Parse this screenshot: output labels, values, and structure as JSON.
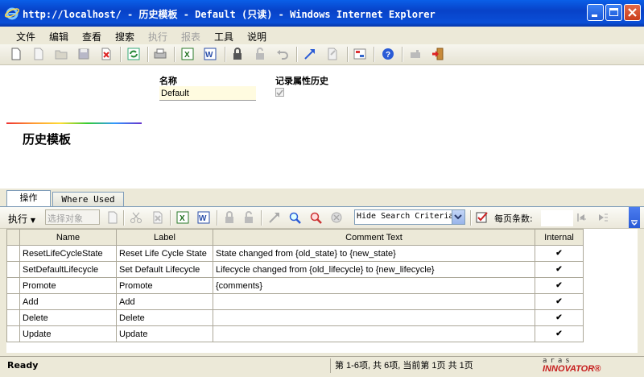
{
  "window": {
    "title": "http://localhost/ - 历史模板 - Default (只读) - Windows Internet Explorer"
  },
  "menu": {
    "items": [
      {
        "label": "文件",
        "enabled": true
      },
      {
        "label": "编辑",
        "enabled": true
      },
      {
        "label": "查看",
        "enabled": true
      },
      {
        "label": "搜索",
        "enabled": true
      },
      {
        "label": "执行",
        "enabled": false
      },
      {
        "label": "报表",
        "enabled": false
      },
      {
        "label": "工具",
        "enabled": true
      },
      {
        "label": "说明",
        "enabled": true
      }
    ]
  },
  "form": {
    "name_label": "名称",
    "name_value": "Default",
    "record_history_label": "记录属性历史",
    "record_history_checked": true,
    "page_title": "历史模板"
  },
  "tabs": [
    {
      "label": "操作",
      "active": true
    },
    {
      "label": "Where Used",
      "active": false
    }
  ],
  "grid_toolbar": {
    "execute_label": "执行",
    "select_placeholder": "选择对象",
    "search_mode": "Hide Search Criteria",
    "per_page_label": "每页条数:",
    "per_page_value": ""
  },
  "grid": {
    "columns": [
      "Name",
      "Label",
      "Comment Text",
      "Internal"
    ],
    "rows": [
      {
        "name": "ResetLifeCycleState",
        "label": "Reset Life Cycle State",
        "comment": "State changed from {old_state} to {new_state}",
        "internal": true
      },
      {
        "name": "SetDefaultLifecycle",
        "label": "Set Default Lifecycle",
        "comment": "Lifecycle changed from {old_lifecycle} to {new_lifecycle}",
        "internal": true
      },
      {
        "name": "Promote",
        "label": "Promote",
        "comment": "{comments}",
        "internal": true
      },
      {
        "name": "Add",
        "label": "Add",
        "comment": "",
        "internal": true
      },
      {
        "name": "Delete",
        "label": "Delete",
        "comment": "",
        "internal": true
      },
      {
        "name": "Update",
        "label": "Update",
        "comment": "",
        "internal": true
      }
    ]
  },
  "status": {
    "ready": "Ready",
    "page_info": "第 1-6项, 共 6项, 当前第 1页 共 1页",
    "brand_top": "aras",
    "brand": "INNOVATOR®"
  },
  "colors": {
    "titlebar": "#0a4fd8",
    "input_bg": "#fffbe0",
    "brand_red": "#c61c1c"
  }
}
